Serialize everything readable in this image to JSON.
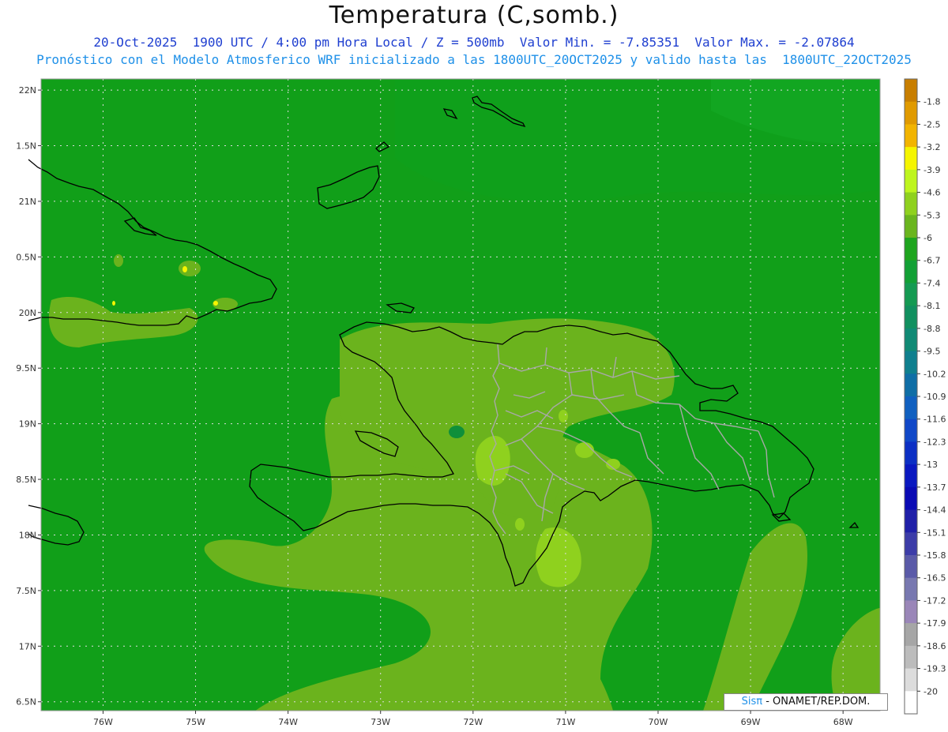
{
  "header": {
    "title": "Temperatura (C,somb.)",
    "line1": "20-Oct-2025  1900 UTC / 4:00 pm Hora Local / Z = 500mb  Valor Min. = -7.85351  Valor Max. = -2.07864",
    "line2": "Pronóstico con el Modelo Atmosferico WRF inicializado a las 1800UTC_20OCT2025 y valido hasta las  1800UTC_22OCT2025"
  },
  "map": {
    "lon_range": [
      -76.67,
      -67.6
    ],
    "lat_range": [
      16.42,
      22.1
    ],
    "lat_labels": [
      "22N",
      "1.5N",
      "21N",
      "0.5N",
      "20N",
      "9.5N",
      "19N",
      "8.5N",
      "18N",
      "7.5N",
      "17N",
      "6.5N"
    ],
    "lon_labels": [
      "76W",
      "75W",
      "74W",
      "73W",
      "72W",
      "71W",
      "70W",
      "69W",
      "68W"
    ],
    "background_color": "#119f19",
    "coast_color": "#000000",
    "province_color": "#a0a0a0"
  },
  "colorbar": {
    "labels": [
      "-1.8",
      "-2.5",
      "-3.2",
      "-3.9",
      "-4.6",
      "-5.3",
      "-6",
      "-6.7",
      "-7.4",
      "-8.1",
      "-8.8",
      "-9.5",
      "-10.2",
      "-10.9",
      "-11.6",
      "-12.3",
      "-13",
      "-13.7",
      "-14.4",
      "-15.1",
      "-15.8",
      "-16.5",
      "-17.2",
      "-17.9",
      "-18.6",
      "-19.3",
      "-20"
    ],
    "colors": [
      "#c87e00",
      "#e09a00",
      "#f2b400",
      "#f5f500",
      "#bef51e",
      "#8fd11e",
      "#6ab51e",
      "#1ea51e",
      "#12a035",
      "#149a52",
      "#11905f",
      "#108a75",
      "#0f7f8e",
      "#0f6ea6",
      "#1060c0",
      "#1048c8",
      "#0c2fc4",
      "#0a18c0",
      "#0a0ab4",
      "#2020a8",
      "#3c3ca8",
      "#5a5aa8",
      "#7878b0",
      "#9a86b8",
      "#a6a6a6",
      "#bcbcbc",
      "#dcdcdc",
      "#ffffff"
    ]
  },
  "credit": {
    "sis": "Sisπ",
    "rest": " - ONAMET/REP.DOM."
  }
}
